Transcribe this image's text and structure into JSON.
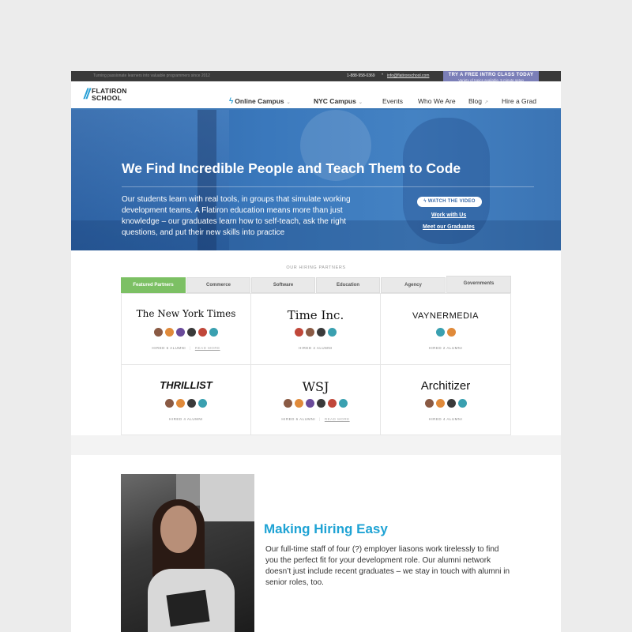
{
  "topbar": {
    "tagline": "Turning passionate learners into valuable programmers since 2012",
    "phone": "1-888-958-0369",
    "email": "info@flatironschool.com",
    "cta_title": "TRY A FREE INTRO CLASS TODAY",
    "cta_sub": "Variety of topics available, 5 minute setup"
  },
  "logo": {
    "line1": "FLATIRON",
    "line2": "SCHOOL",
    "mark": "//"
  },
  "nav": {
    "online": "Online Campus",
    "nyc": "NYC Campus",
    "events": "Events",
    "who": "Who We Are",
    "blog": "Blog",
    "hire": "Hire a Grad",
    "chevron": "⌄"
  },
  "hero": {
    "title": "We Find Incredible People and Teach Them to Code",
    "body": "Our students learn with real tools, in groups that simulate working development teams. A Flatiron education means more than just knowledge – our graduates learn how to self-teach, ask the right questions, and put their new skills into practice",
    "watch": "WATCH THE VIDEO",
    "work": "Work with Us",
    "meet": "Meet our Graduates"
  },
  "partners": {
    "heading": "OUR HIRING PARTNERS",
    "tabs": [
      "Featured Partners",
      "Commerce",
      "Software",
      "Education",
      "Agency",
      "Governments"
    ],
    "read_more": "READ MORE",
    "cells": [
      {
        "name": "The New York Times",
        "meta": "HIRED 6 ALUMNI",
        "avatars": 6,
        "read_more": true
      },
      {
        "name": "Time Inc.",
        "meta": "HIRED 4 ALUMNI",
        "avatars": 4,
        "read_more": false
      },
      {
        "name": "VAYNERMEDIA",
        "meta": "HIRED 2 ALUMNI",
        "avatars": 2,
        "read_more": false
      },
      {
        "name": "THRILLIST",
        "meta": "HIRED 4 ALUMNI",
        "avatars": 4,
        "read_more": false
      },
      {
        "name": "WSJ",
        "meta": "HIRED 6 ALUMNI",
        "avatars": 6,
        "read_more": true
      },
      {
        "name": "Architizer",
        "meta": "HIRED 4 ALUMNI",
        "avatars": 4,
        "read_more": false
      }
    ]
  },
  "lower": {
    "title": "Making Hiring Easy",
    "body": "Our full-time staff of four (?) employer liasons work tirelessly to find you the perfect fit for your development role. Our alumni network doesn’t just include recent graduates – we stay in touch with alumni in senior roles, too."
  },
  "colors": {
    "accent_blue": "#1fa3d4",
    "hero_blue": "#3a78bc",
    "active_tab_green": "#7cc064",
    "cta_purple": "#7b7fb8"
  }
}
